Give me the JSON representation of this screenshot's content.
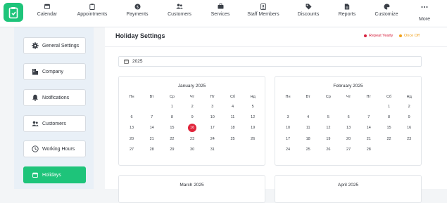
{
  "nav": [
    {
      "label": "Calendar",
      "icon": "calendar-icon"
    },
    {
      "label": "Appointments",
      "icon": "clipboard-icon"
    },
    {
      "label": "Payments",
      "icon": "dollar-icon"
    },
    {
      "label": "Customers",
      "icon": "users-icon"
    },
    {
      "label": "Services",
      "icon": "briefcase-icon"
    },
    {
      "label": "Staff Members",
      "icon": "id-badge-icon"
    },
    {
      "label": "Discounts",
      "icon": "tag-icon"
    },
    {
      "label": "Reports",
      "icon": "file-icon"
    },
    {
      "label": "Customize",
      "icon": "palette-icon"
    },
    {
      "label": "More",
      "icon": "ellipsis-icon"
    }
  ],
  "sidebar": [
    {
      "label": "General Settings",
      "icon": "gear-icon",
      "active": false
    },
    {
      "label": "Company",
      "icon": "building-icon",
      "active": false
    },
    {
      "label": "Notifications",
      "icon": "bell-icon",
      "active": false
    },
    {
      "label": "Customers",
      "icon": "users-icon",
      "active": false
    },
    {
      "label": "Working Hours",
      "icon": "clock-icon",
      "active": false
    },
    {
      "label": "Holidays",
      "icon": "calendar-icon",
      "active": true
    }
  ],
  "page": {
    "title": "Holiday Settings",
    "legend": [
      {
        "label": "Repeat Yearly",
        "color": "#d6223f"
      },
      {
        "label": "Once Off",
        "color": "#f0a11c"
      }
    ],
    "year": "2025"
  },
  "weekdays": [
    "Пн",
    "Вт",
    "Ср",
    "Чт",
    "Пт",
    "Сб",
    "Нд"
  ],
  "months": [
    {
      "title": "January 2025",
      "weeks": [
        [
          "",
          "",
          "1",
          "2",
          "3",
          "4",
          "5"
        ],
        [
          "6",
          "7",
          "8",
          "9",
          "10",
          "11",
          "12"
        ],
        [
          "13",
          "14",
          "15",
          "16",
          "17",
          "18",
          "19"
        ],
        [
          "20",
          "21",
          "22",
          "23",
          "24",
          "25",
          "26"
        ],
        [
          "27",
          "28",
          "29",
          "30",
          "31",
          "",
          ""
        ]
      ],
      "holidays": [
        "16"
      ]
    },
    {
      "title": "February 2025",
      "weeks": [
        [
          "",
          "",
          "",
          "",
          "",
          "1",
          "2"
        ],
        [
          "3",
          "4",
          "5",
          "6",
          "7",
          "8",
          "9"
        ],
        [
          "10",
          "11",
          "12",
          "13",
          "14",
          "15",
          "16"
        ],
        [
          "17",
          "18",
          "19",
          "20",
          "21",
          "22",
          "23"
        ],
        [
          "24",
          "25",
          "26",
          "27",
          "28",
          "",
          ""
        ]
      ],
      "holidays": []
    },
    {
      "title": "March 2025",
      "weeks": [],
      "holidays": []
    },
    {
      "title": "April 2025",
      "weeks": [],
      "holidays": []
    }
  ]
}
